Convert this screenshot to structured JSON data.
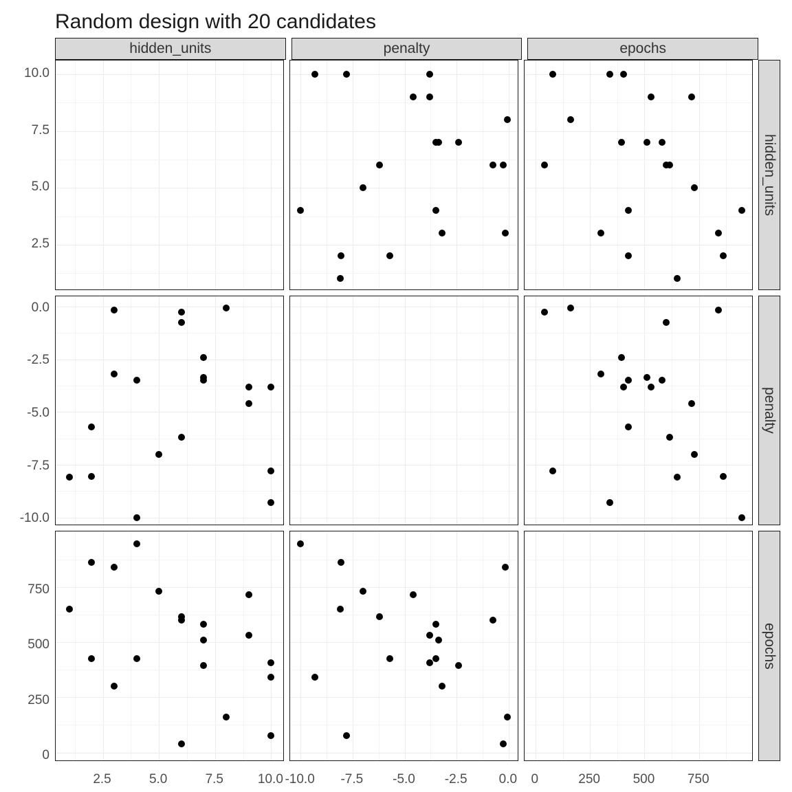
{
  "title": "Random design with 20 candidates",
  "variables": [
    "hidden_units",
    "penalty",
    "epochs"
  ],
  "chart_data": {
    "type": "scatter",
    "layout": "pairs-matrix (3x3, diagonal empty)",
    "candidates": [
      {
        "hidden_units": 1,
        "penalty": -8.1,
        "epochs": 650
      },
      {
        "hidden_units": 2,
        "penalty": -5.7,
        "epochs": 425
      },
      {
        "hidden_units": 2,
        "penalty": -8.05,
        "epochs": 860
      },
      {
        "hidden_units": 3,
        "penalty": -3.2,
        "epochs": 300
      },
      {
        "hidden_units": 3,
        "penalty": -0.15,
        "epochs": 840
      },
      {
        "hidden_units": 4,
        "penalty": -3.5,
        "epochs": 425
      },
      {
        "hidden_units": 4,
        "penalty": -10.0,
        "epochs": 945
      },
      {
        "hidden_units": 5,
        "penalty": -7.0,
        "epochs": 730
      },
      {
        "hidden_units": 6,
        "penalty": -6.2,
        "epochs": 615
      },
      {
        "hidden_units": 6,
        "penalty": -0.25,
        "epochs": 40
      },
      {
        "hidden_units": 6,
        "penalty": -0.75,
        "epochs": 600
      },
      {
        "hidden_units": 7,
        "penalty": -3.5,
        "epochs": 580
      },
      {
        "hidden_units": 7,
        "penalty": -3.35,
        "epochs": 510
      },
      {
        "hidden_units": 7,
        "penalty": -2.4,
        "epochs": 395
      },
      {
        "hidden_units": 8,
        "penalty": -0.05,
        "epochs": 160
      },
      {
        "hidden_units": 9,
        "penalty": -3.8,
        "epochs": 530
      },
      {
        "hidden_units": 9,
        "penalty": -4.6,
        "epochs": 715
      },
      {
        "hidden_units": 10,
        "penalty": -7.8,
        "epochs": 78
      },
      {
        "hidden_units": 10,
        "penalty": -3.8,
        "epochs": 405
      },
      {
        "hidden_units": 10,
        "penalty": -9.3,
        "epochs": 340
      }
    ],
    "axes": {
      "hidden_units": {
        "range": [
          0.4,
          10.6
        ],
        "ticks": [
          2.5,
          5.0,
          7.5,
          10.0
        ],
        "labels": [
          "2.5",
          "5.0",
          "7.5",
          "10.0"
        ]
      },
      "penalty": {
        "range": [
          -10.5,
          0.5
        ],
        "ticks": [
          -10.0,
          -7.5,
          -5.0,
          -2.5,
          0.0
        ],
        "labels": [
          "-10.0",
          "-7.5",
          "-5.0",
          "-2.5",
          "0.0"
        ]
      },
      "epochs": {
        "range": [
          -50,
          1000
        ],
        "ticks": [
          0,
          250,
          500,
          750
        ],
        "labels": [
          "0",
          "250",
          "500",
          "750"
        ]
      }
    }
  }
}
